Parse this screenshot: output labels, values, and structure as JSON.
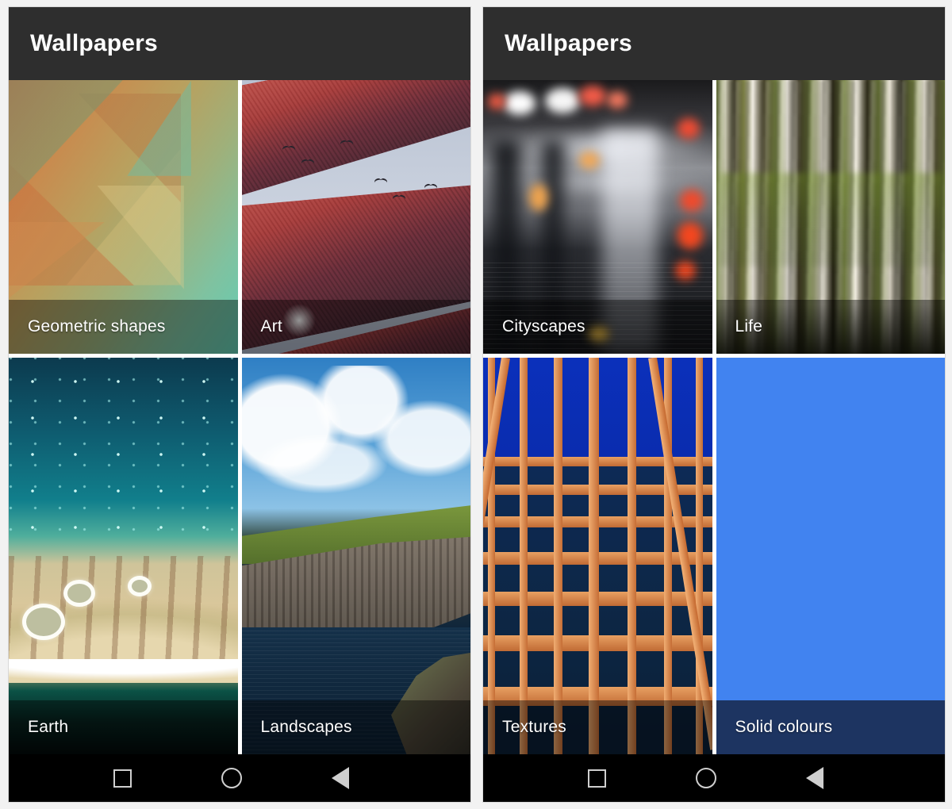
{
  "screens": [
    {
      "id": "left",
      "appbar": {
        "title": "Wallpapers"
      },
      "tiles": [
        {
          "label": "Geometric shapes",
          "art": "low-poly-orange-green",
          "position": "top-left"
        },
        {
          "label": "Art",
          "art": "red-mountain-collage-birds",
          "position": "top-right"
        },
        {
          "label": "Earth",
          "art": "aerial-atoll-teal-sand",
          "position": "bottom-left"
        },
        {
          "label": "Landscapes",
          "art": "sea-cliffs-clouds",
          "position": "bottom-right"
        }
      ],
      "navbar": {
        "recents": "recents-square",
        "home": "home-circle",
        "back": "back-triangle"
      }
    },
    {
      "id": "right",
      "appbar": {
        "title": "Wallpapers"
      },
      "tiles": [
        {
          "label": "Cityscapes",
          "art": "wet-street-bokeh-night",
          "position": "top-left"
        },
        {
          "label": "Life",
          "art": "motion-blur-birch-forest",
          "position": "top-right"
        },
        {
          "label": "Textures",
          "art": "orange-facade-grid-blue-sky",
          "position": "bottom-left"
        },
        {
          "label": "Solid colours",
          "art": "flat-blue",
          "position": "bottom-right"
        }
      ],
      "navbar": {
        "recents": "recents-square",
        "home": "home-circle",
        "back": "back-triangle"
      }
    }
  ],
  "colors": {
    "appbar_background": "#2e2e2e",
    "appbar_title": "#ffffff",
    "navbar_background": "#000000",
    "navbar_icon": "#cfcfcf",
    "tile_scrim": "rgba(0,0,0,0.42)",
    "solid_colours_swatch": "#4183f0",
    "solid_colours_label_band": "#1d3461",
    "page_background": "#f2f2f2"
  }
}
